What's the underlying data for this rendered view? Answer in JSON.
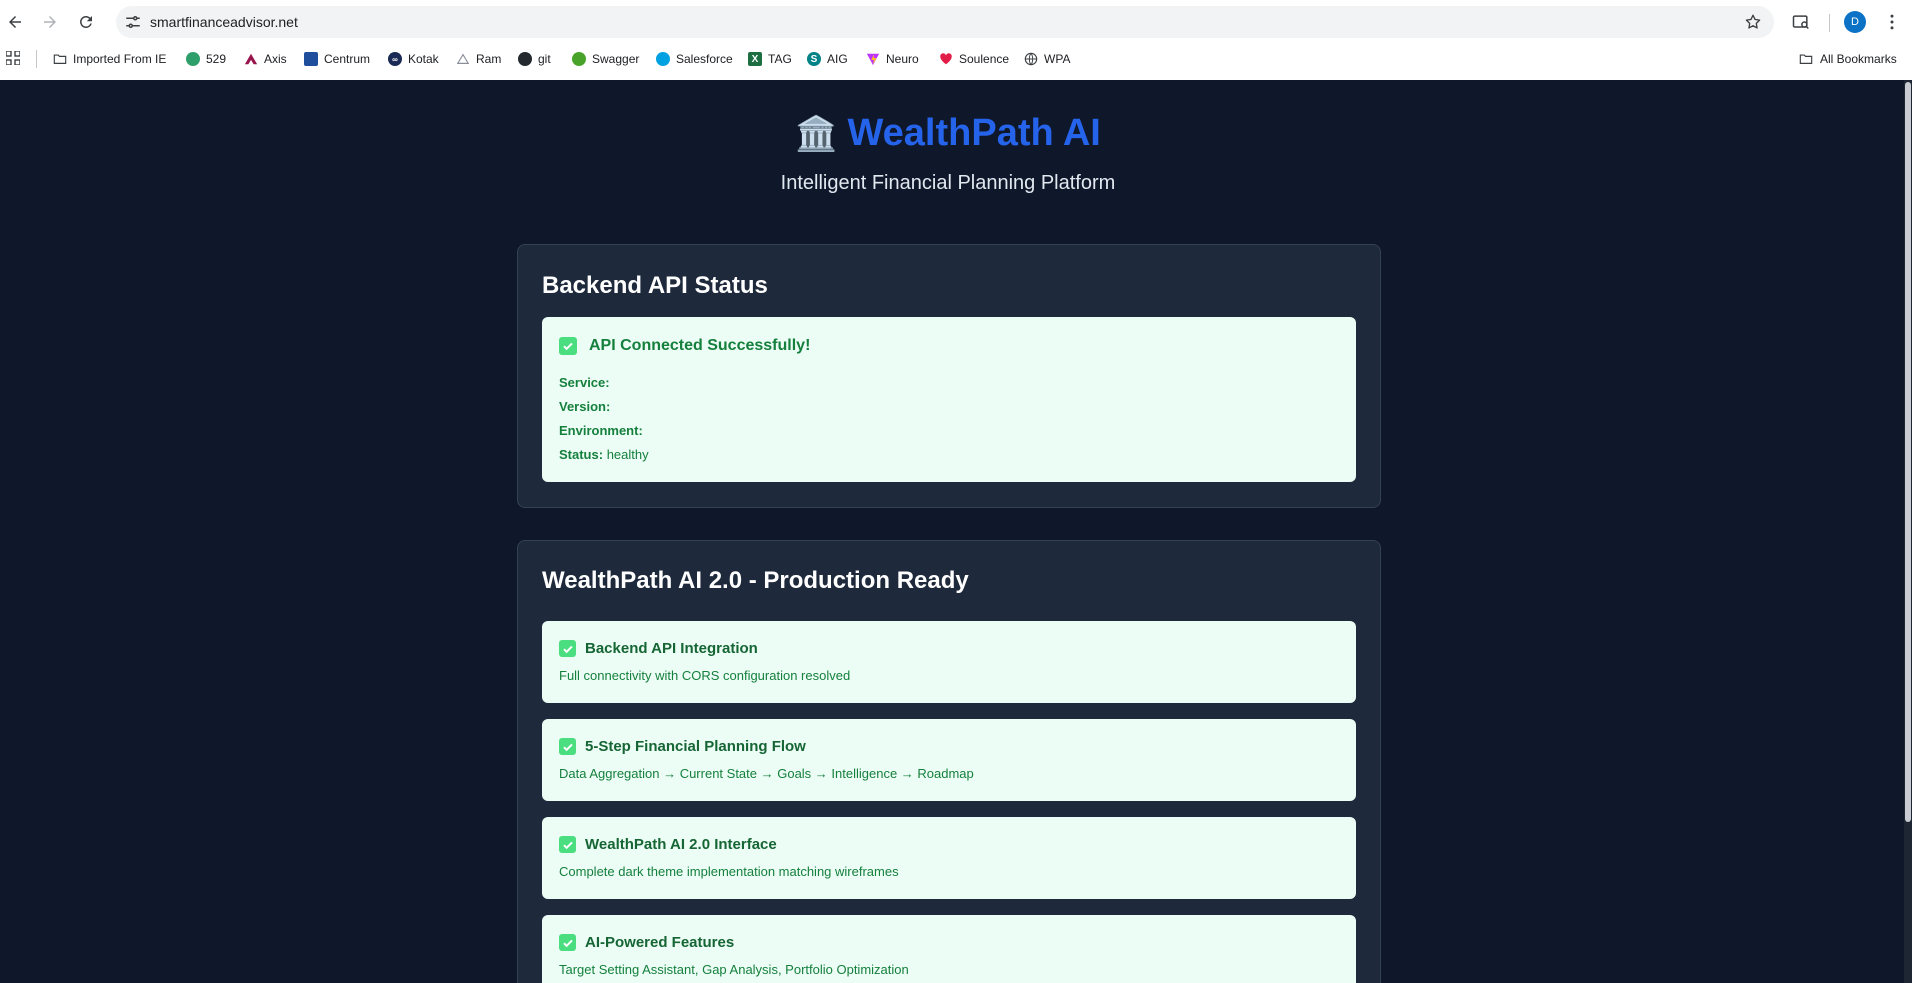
{
  "browser": {
    "url": "smartfinanceadvisor.net",
    "profile_initial": "D",
    "bookmarks": [
      {
        "label": "Imported From IE",
        "icon": "folder-icon"
      },
      {
        "label": "529",
        "icon": "globe-icon"
      },
      {
        "label": "Axis",
        "icon": "axis-icon"
      },
      {
        "label": "Centrum",
        "icon": "centrum-icon"
      },
      {
        "label": "Kotak",
        "icon": "kotak-icon"
      },
      {
        "label": "Ram",
        "icon": "ram-icon"
      },
      {
        "label": "git",
        "icon": "github-icon"
      },
      {
        "label": "Swagger",
        "icon": "swagger-icon"
      },
      {
        "label": "Salesforce",
        "icon": "salesforce-icon"
      },
      {
        "label": "TAG",
        "icon": "excel-icon"
      },
      {
        "label": "AIG",
        "icon": "sharepoint-icon"
      },
      {
        "label": "Neuro",
        "icon": "vite-icon"
      },
      {
        "label": "Soulence",
        "icon": "heart-icon"
      },
      {
        "label": "WPA",
        "icon": "globe-icon"
      }
    ],
    "all_bookmarks_label": "All Bookmarks"
  },
  "app": {
    "brand_emoji": "🏛️",
    "title": "WealthPath AI",
    "tagline": "Intelligent Financial Planning Platform"
  },
  "api_status": {
    "heading": "Backend API Status",
    "message": "API Connected Successfully!",
    "fields": [
      {
        "label": "Service:",
        "value": ""
      },
      {
        "label": "Version:",
        "value": ""
      },
      {
        "label": "Environment:",
        "value": ""
      },
      {
        "label": "Status:",
        "value": "healthy"
      }
    ]
  },
  "production": {
    "heading": "WealthPath AI 2.0 - Production Ready",
    "features": [
      {
        "title": "Backend API Integration",
        "description": "Full connectivity with CORS configuration resolved"
      },
      {
        "title": "5-Step Financial Planning Flow",
        "description": "Data Aggregation → Current State → Goals → Intelligence → Roadmap"
      },
      {
        "title": "WealthPath AI 2.0 Interface",
        "description": "Complete dark theme implementation matching wireframes"
      },
      {
        "title": "AI-Powered Features",
        "description": "Target Setting Assistant, Gap Analysis, Portfolio Optimization"
      }
    ]
  },
  "colors": {
    "page_bg": "#0f172a",
    "card_bg": "#1e293b",
    "brand_blue": "#2563eb",
    "success_bg": "#ecfdf5",
    "success_text": "#15803d"
  }
}
